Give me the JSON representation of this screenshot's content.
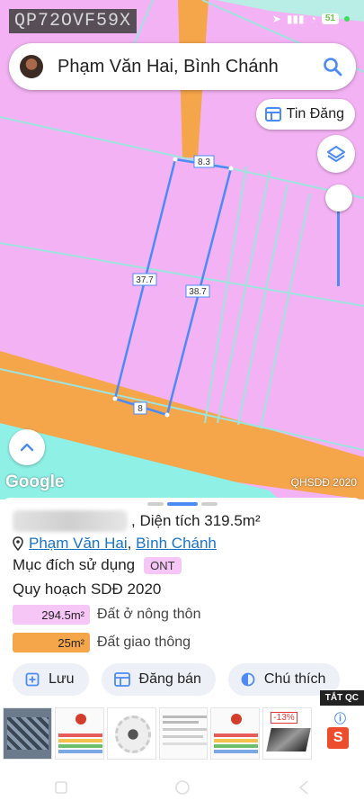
{
  "watermark": "QP72OVF59X",
  "status": {
    "battery": "51"
  },
  "search": {
    "query": "Phạm Văn Hai, Bình Chánh"
  },
  "map": {
    "tin_dang_label": "Tin Đăng",
    "dimensions": {
      "top": "8.3",
      "left": "37.7",
      "right": "38.7",
      "bottom": "8"
    },
    "google_label": "Google",
    "source_label": "QHSDĐ 2020"
  },
  "parcel": {
    "area_label": ", Diện tích 319.5m²",
    "address_street": "Phạm Văn Hai",
    "address_sep": ",",
    "address_district": "Bình Chánh",
    "purpose_label": "Mục đích sử dụng",
    "purpose_code": "ONT",
    "plan_label": "Quy hoạch SDĐ 2020",
    "legend": [
      {
        "area": "294.5m²",
        "label": "Đất ở nông thôn",
        "color": "#f6c6f6"
      },
      {
        "area": "25m²",
        "label": "Đất giao thông",
        "color": "#f5a54a"
      }
    ]
  },
  "actions": {
    "save": "Lưu",
    "post_sale": "Đăng bán",
    "legend": "Chú thích"
  },
  "ads": {
    "close_label": "TẮT QC",
    "discount": "-13%"
  },
  "colors": {
    "accent": "#4c8bf5",
    "land_residential": "#f3b2f3",
    "land_transport": "#f5a54a",
    "water": "#8ff0e6"
  }
}
